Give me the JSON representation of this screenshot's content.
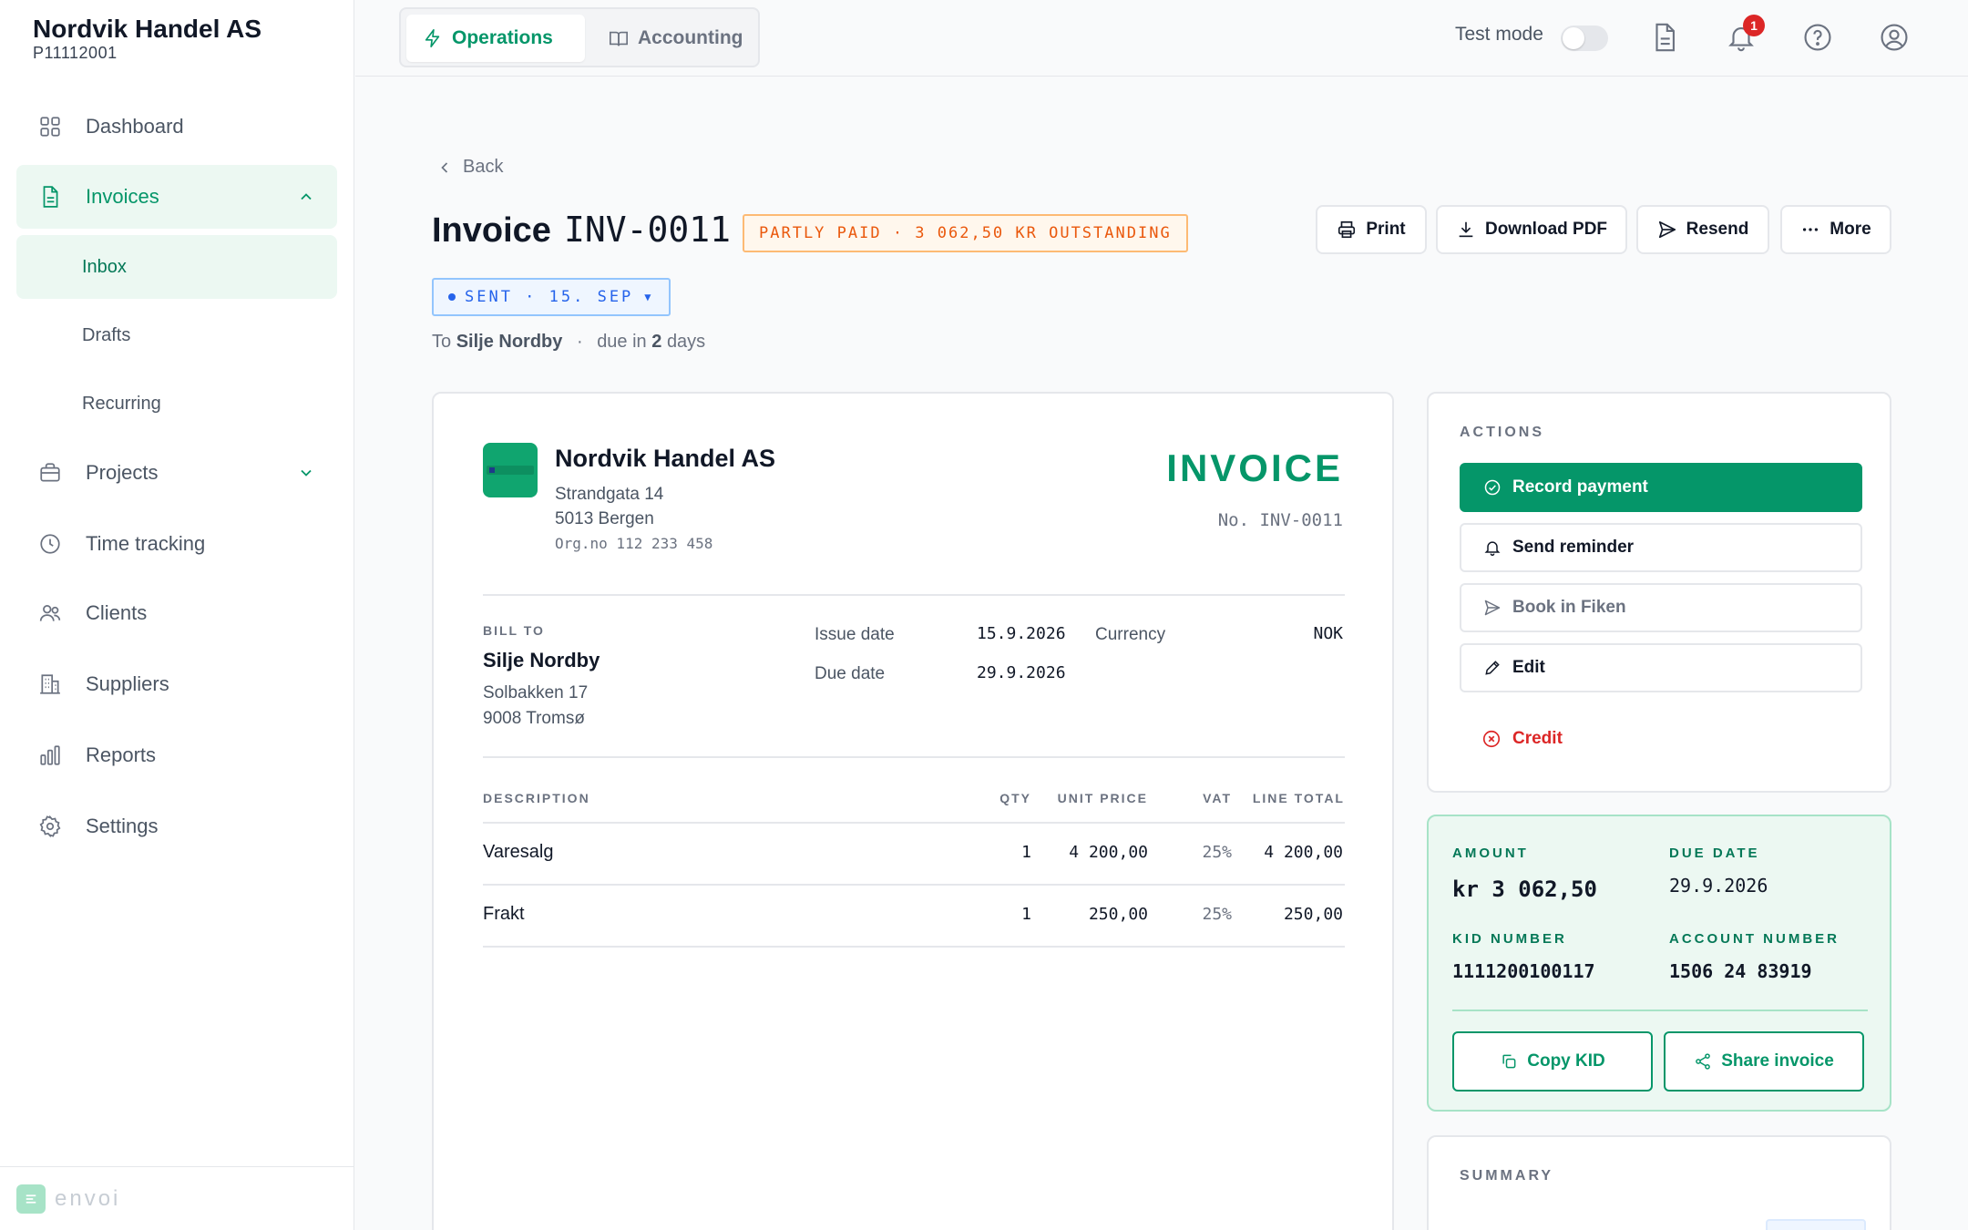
{
  "sidebar": {
    "org_name": "Nordvik Handel AS",
    "org_id": "P11112001",
    "items": [
      {
        "label": "Dashboard",
        "icon": "grid-icon"
      },
      {
        "label": "Invoices",
        "icon": "document-icon"
      },
      {
        "label": "Projects",
        "icon": "briefcase-icon"
      },
      {
        "label": "Time tracking",
        "icon": "clock-icon"
      },
      {
        "label": "Clients",
        "icon": "users-icon"
      },
      {
        "label": "Suppliers",
        "icon": "building-icon"
      },
      {
        "label": "Reports",
        "icon": "bar-chart-icon"
      },
      {
        "label": "Settings",
        "icon": "gear-icon"
      }
    ],
    "subitems": [
      "Inbox",
      "Drafts",
      "Recurring"
    ],
    "brand": "envoi"
  },
  "topbar": {
    "tabs": [
      {
        "label": "Operations",
        "icon": "bolt-icon",
        "active": true
      },
      {
        "label": "Accounting",
        "icon": "book-icon",
        "active": false
      }
    ],
    "test_mode_label": "Test mode",
    "notification_count": "1"
  },
  "header": {
    "back_label": "Back",
    "title_word": "Invoice",
    "invoice_number": "INV-0011",
    "status": "PARTLY PAID · 3 062,50 KR OUTSTANDING",
    "sent_status": "SENT · 15. SEP",
    "to_prefix": "To",
    "client_name": "Silje Nordby",
    "separator": "·",
    "due_prefix": "due in",
    "due_days": "2",
    "due_suffix": "days",
    "buttons": {
      "print": "Print",
      "download": "Download PDF",
      "resend": "Resend",
      "more": "More"
    }
  },
  "invoice": {
    "company": {
      "name": "Nordvik Handel AS",
      "address1": "Strandgata 14",
      "address2": "5013 Bergen",
      "org": "Org.no 112 233 458"
    },
    "heading": "INVOICE",
    "number_label": "No. INV-0011",
    "bill_to_label": "BILL TO",
    "bill_to": {
      "name": "Silje Nordby",
      "address1": "Solbakken 17",
      "address2": "9008 Tromsø"
    },
    "issue_date_label": "Issue date",
    "issue_date": "15.9.2026",
    "due_date_label": "Due date",
    "due_date": "29.9.2026",
    "currency_label": "Currency",
    "currency": "NOK",
    "columns": {
      "description": "DESCRIPTION",
      "qty": "QTY",
      "unit_price": "UNIT PRICE",
      "vat": "VAT",
      "line_total": "LINE TOTAL"
    },
    "lines": [
      {
        "description": "Varesalg",
        "qty": "1",
        "unit_price": "4 200,00",
        "vat": "25%",
        "line_total": "4 200,00"
      },
      {
        "description": "Frakt",
        "qty": "1",
        "unit_price": "250,00",
        "vat": "25%",
        "line_total": "250,00"
      }
    ]
  },
  "actions": {
    "label": "ACTIONS",
    "record_payment": "Record payment",
    "send_reminder": "Send reminder",
    "book_in_fiken": "Book in Fiken",
    "edit": "Edit",
    "credit": "Credit"
  },
  "payment": {
    "amount_label": "AMOUNT",
    "amount": "kr 3 062,50",
    "due_date_label": "DUE DATE",
    "due_date": "29.9.2026",
    "kid_label": "KID NUMBER",
    "kid": "1111200100117",
    "account_label": "ACCOUNT NUMBER",
    "account": "1506 24 83919",
    "copy_kid": "Copy KID",
    "share_invoice": "Share invoice"
  },
  "summary": {
    "label": "SUMMARY"
  },
  "colors": {
    "accent": "#059669",
    "accent_bg": "#ecf8f2",
    "warning": "#ea580c",
    "info": "#2563eb",
    "danger": "#dc2626"
  }
}
